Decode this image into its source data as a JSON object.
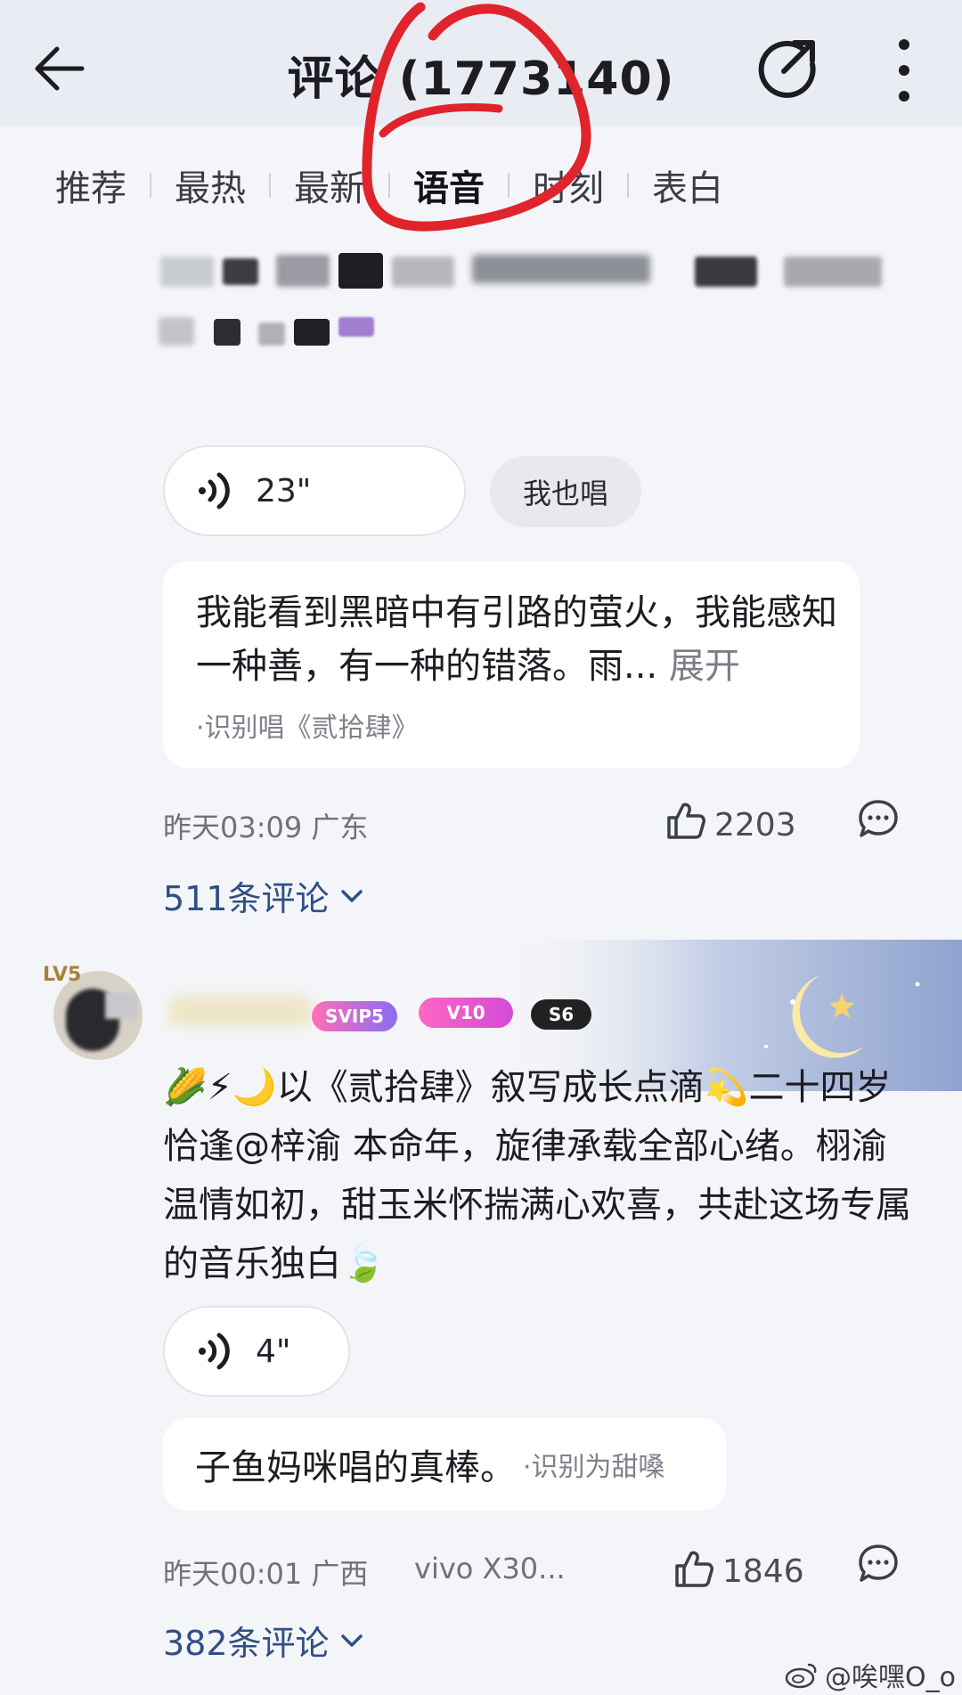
{
  "header": {
    "title": "评论 (1773140)",
    "back_icon": "arrow-left-icon",
    "share_icon": "share-icon",
    "more_icon": "more-vertical-icon"
  },
  "tabs": [
    {
      "label": "推荐",
      "active": false
    },
    {
      "label": "最热",
      "active": false
    },
    {
      "label": "最新",
      "active": false
    },
    {
      "label": "语音",
      "active": true
    },
    {
      "label": "时刻",
      "active": false
    },
    {
      "label": "表白",
      "active": false
    }
  ],
  "comment1": {
    "voice_duration": "23\"",
    "sing_label": "我也唱",
    "lyric": "我能看到黑暗中有引路的萤火，我能感知一种善，有一种的错落。雨...",
    "expand": "展开",
    "recognized": "·识别唱《贰拾肆》",
    "time_location": "昨天03:09 广东",
    "likes": "2203",
    "replies": "511条评论"
  },
  "comment2": {
    "level": "LV5",
    "badges": [
      "SVIP5",
      "V10",
      "S6"
    ],
    "text": "🌽⚡🌙以《贰拾肆》叙写成长点滴💫二十四岁恰逢@梓渝 本命年，旋律承载全部心绪。栩渝温情如初，甜玉米怀揣满心欢喜，共赴这场专属的音乐独白🍃",
    "voice_duration": "4\"",
    "recog_text": "子鱼妈咪唱的真棒。",
    "recog_label": "·识别为甜嗓",
    "time_location": "昨天00:01 广西",
    "device": "vivo X30...",
    "likes": "1846",
    "replies": "382条评论"
  },
  "watermark": "@唉嘿O_o",
  "colors": {
    "annotation": "#e0242c",
    "reply_link": "#2f4f86",
    "header_bg": "#e9ecf3"
  }
}
